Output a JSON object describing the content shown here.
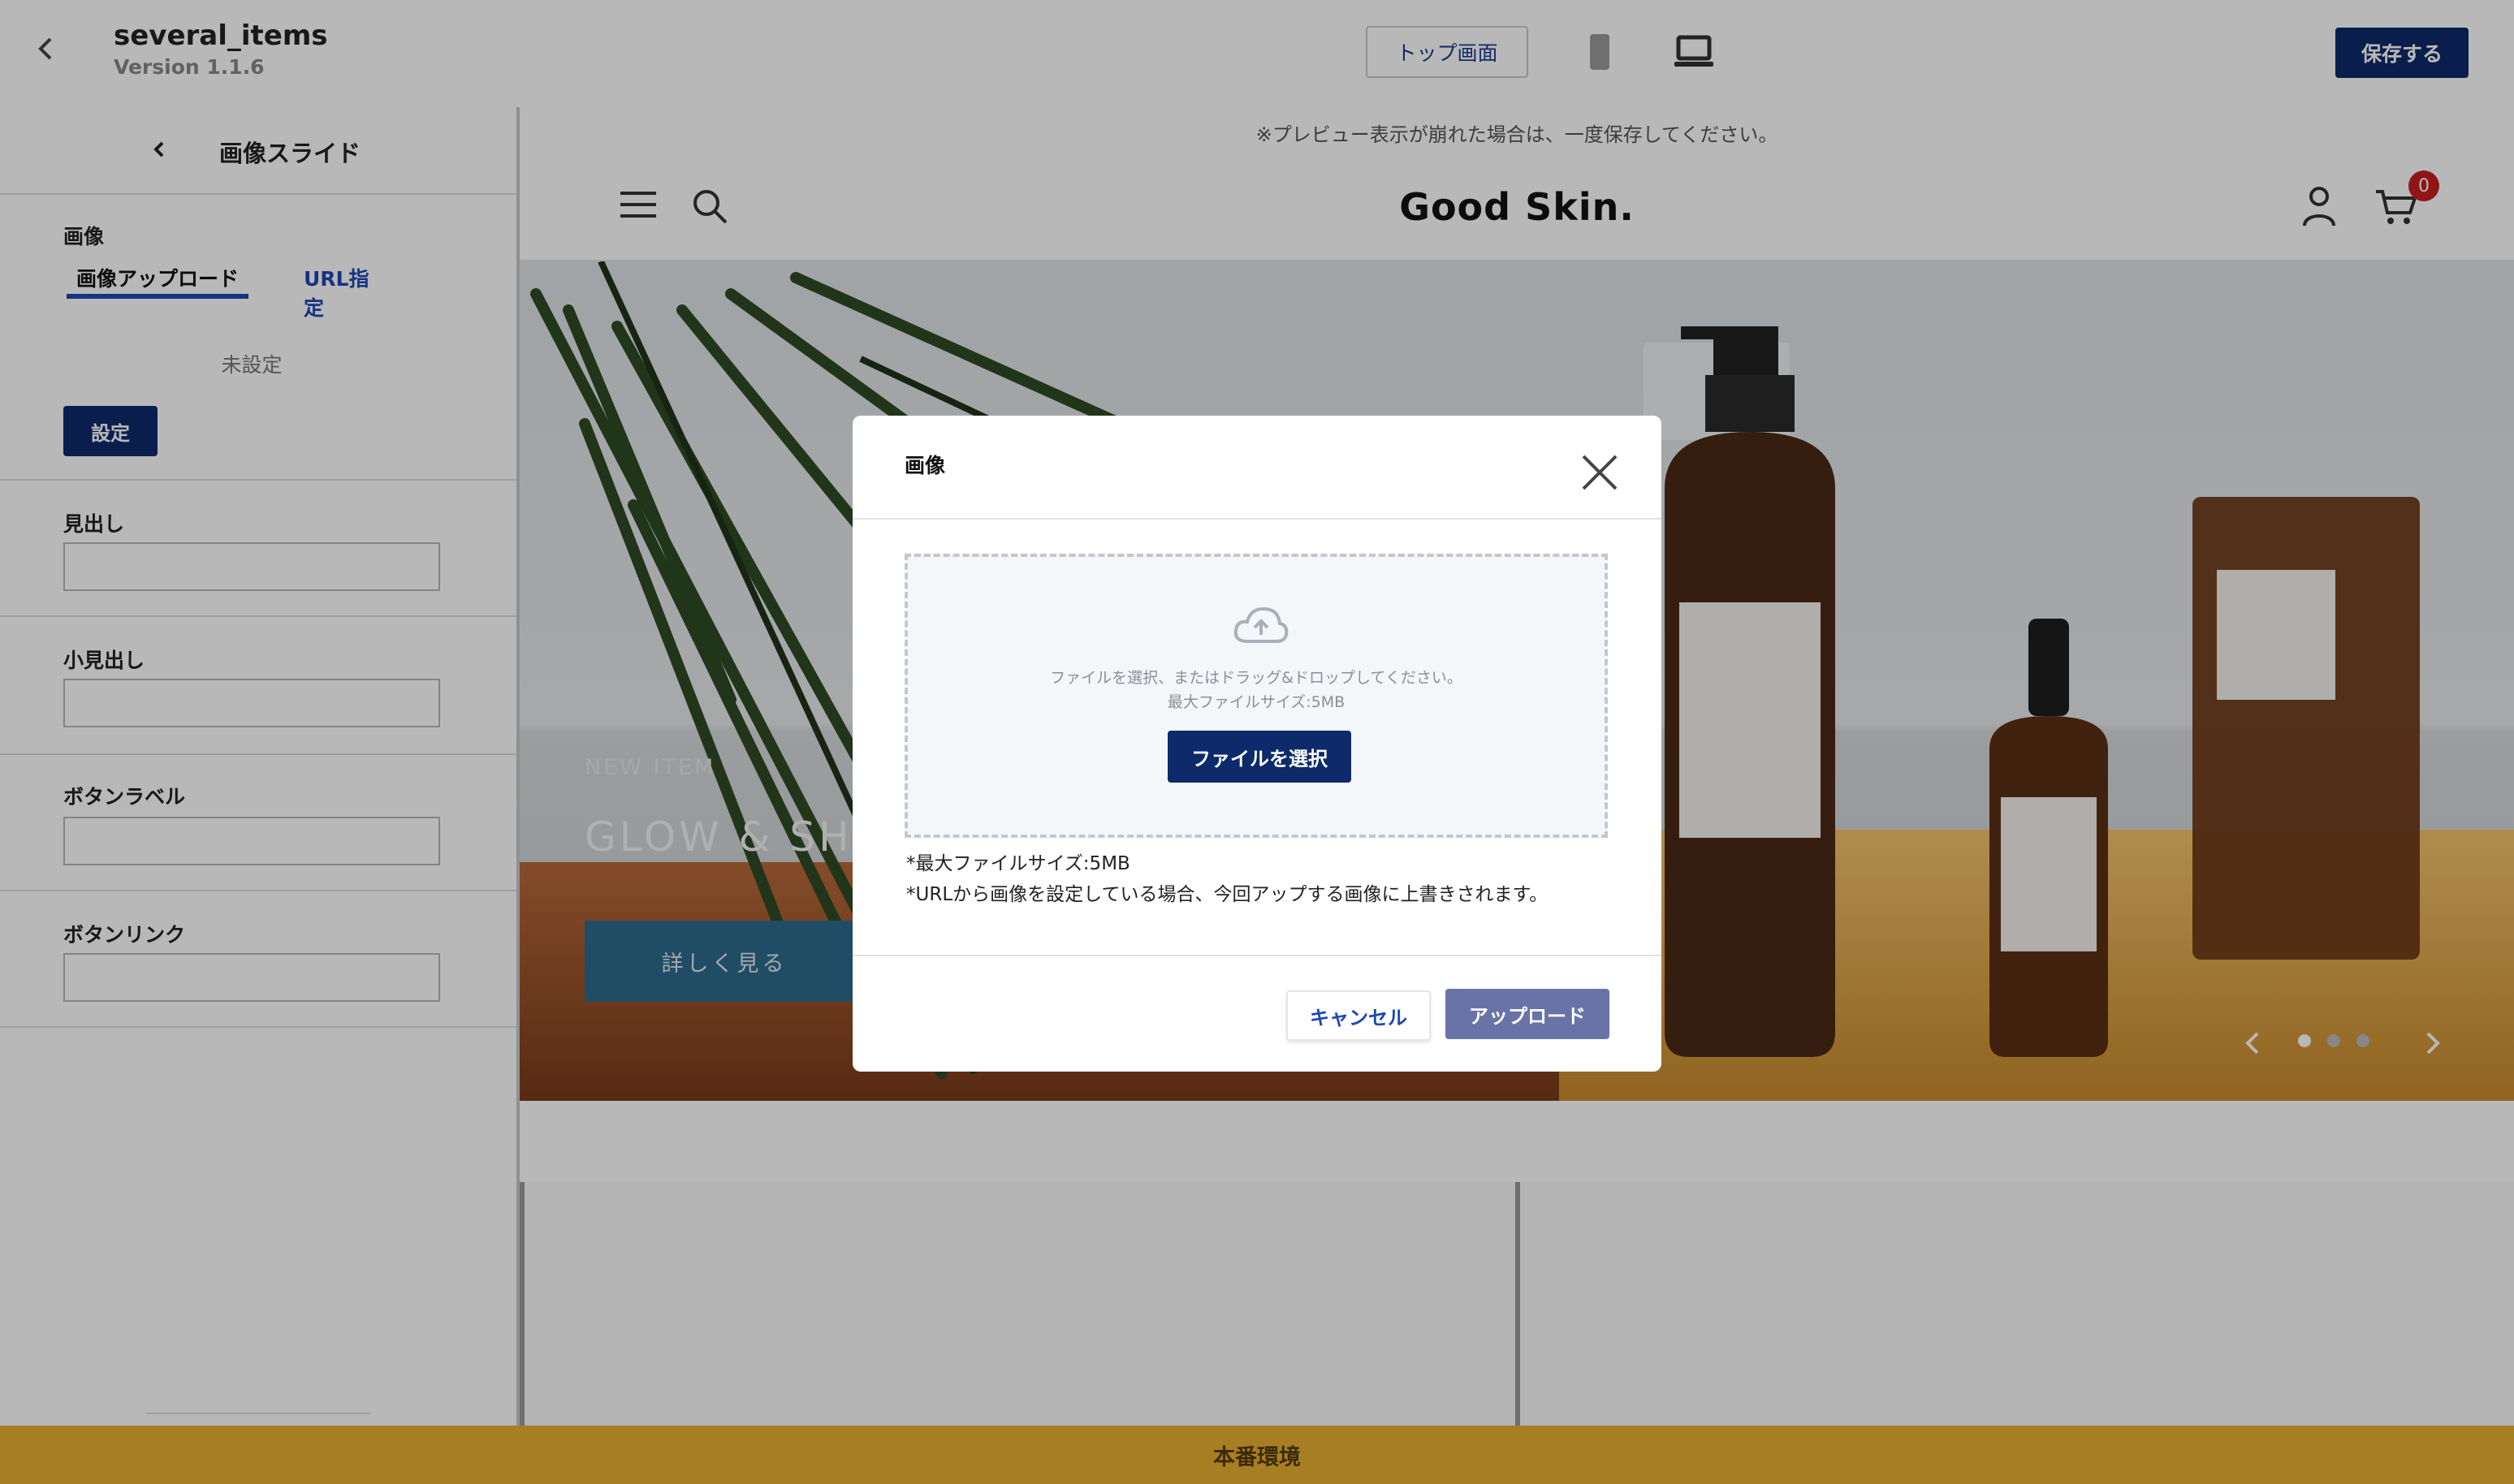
{
  "header": {
    "app_name": "several_items",
    "version": "Version 1.1.6",
    "top_screen_button": "トップ画面",
    "save_button": "保存する"
  },
  "sidebar": {
    "title": "画像スライド",
    "image_label": "画像",
    "tabs": [
      {
        "label": "画像アップロード",
        "active": true
      },
      {
        "label": "URL指定",
        "active": false
      }
    ],
    "unset_text": "未設定",
    "set_button": "設定",
    "fields": [
      {
        "label": "見出し",
        "value": ""
      },
      {
        "label": "小見出し",
        "value": ""
      },
      {
        "label": "ボタンラベル",
        "value": ""
      },
      {
        "label": "ボタンリンク",
        "value": ""
      }
    ]
  },
  "preview": {
    "notice": "※プレビュー表示が崩れた場合は、一度保存してください。",
    "logo": "Good Skin.",
    "cart_count": "0",
    "hero": {
      "eyebrow": "NEW ITEM",
      "title": "GLOW & SHIN",
      "button": "詳しく見る"
    }
  },
  "modal": {
    "title": "画像",
    "dropzone_text": "ファイルを選択、またはドラッグ&ドロップしてください。",
    "dropzone_max": "最大ファイルサイズ:5MB",
    "select_file_button": "ファイルを選択",
    "note1": "*最大ファイルサイズ:5MB",
    "note2": "*URLから画像を設定している場合、今回アップする画像に上書きされます。",
    "cancel_button": "キャンセル",
    "upload_button": "アップロード"
  },
  "footer": {
    "environment": "本番環境"
  },
  "colors": {
    "primary": "#0d2a6b",
    "link": "#1f47b3",
    "upload_button": "#6973a8",
    "env_bar": "#a87e22",
    "badge": "#c81e1e"
  }
}
